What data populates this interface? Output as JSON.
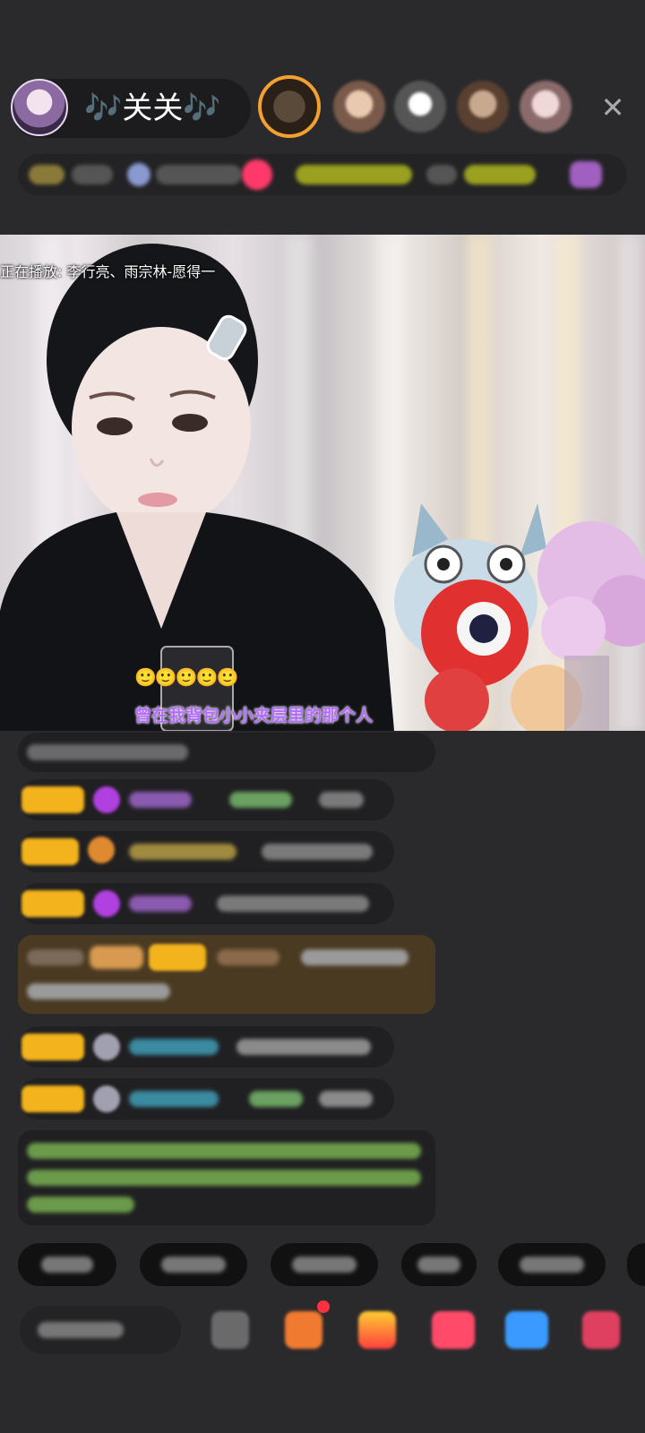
{
  "header": {
    "host_name": "🎶关关🎶",
    "close_glyph": "✕"
  },
  "video": {
    "now_playing": "正在播放: 李行亮、雨宗林-愿得一",
    "subtitle": "曾在我背包小小夹层里的那个人",
    "reaction_emojis": "🙂🙂🙂🙂🙂"
  },
  "colors": {
    "background": "#2a2a2c",
    "subtitle": "#b36bff",
    "badge": "#f2b31c",
    "chat_bubble": "#202022"
  },
  "icons": [
    "avatar",
    "viewer-avatar",
    "close-icon",
    "gem-icon",
    "gift-icon",
    "share-icon",
    "more-icon"
  ]
}
